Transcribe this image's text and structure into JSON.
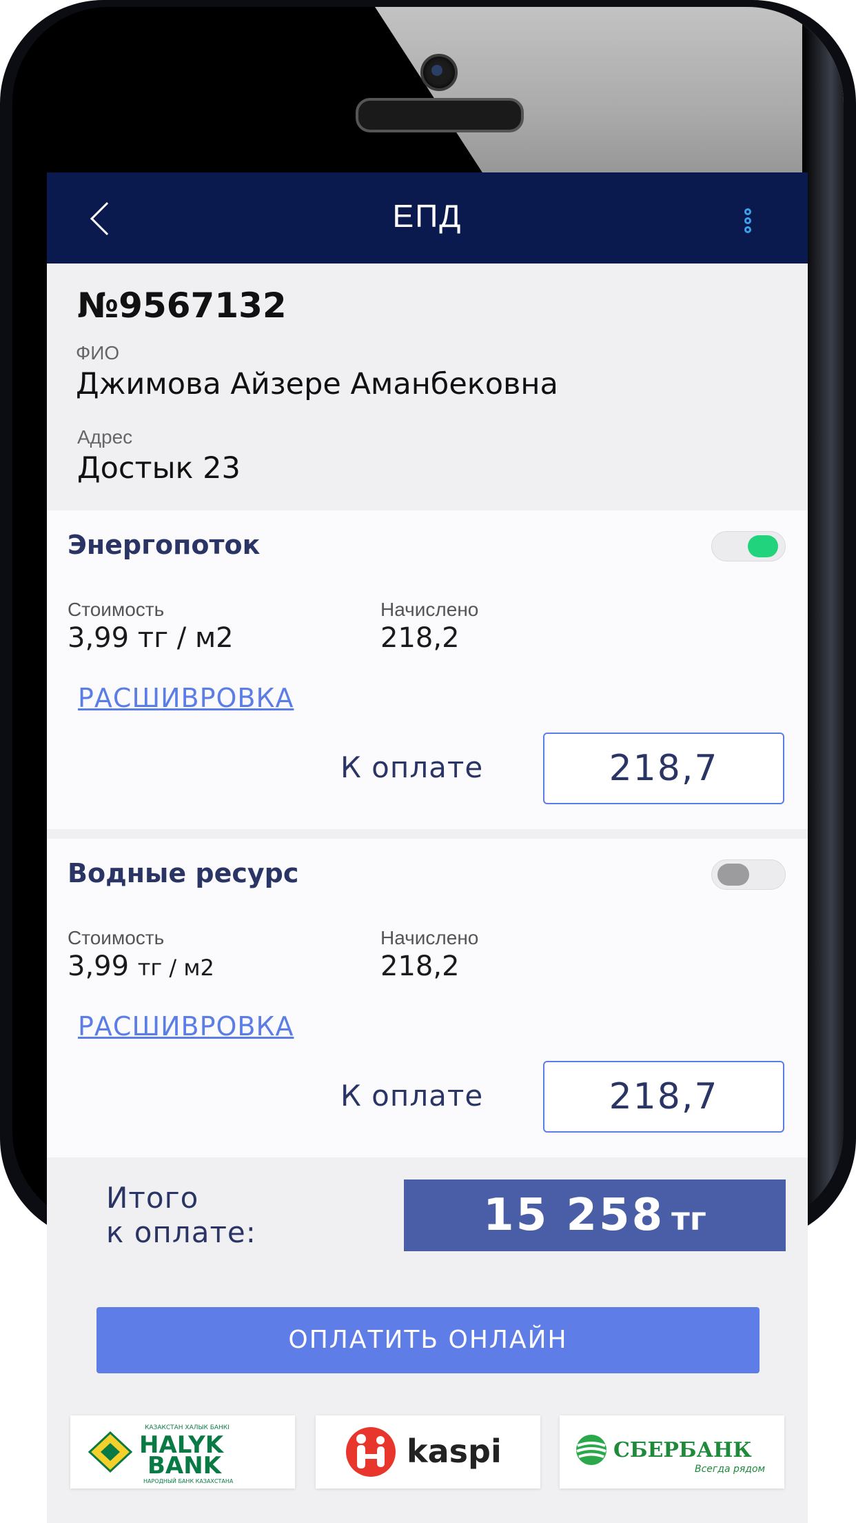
{
  "header": {
    "title": "ЕПД"
  },
  "account": {
    "number": "№9567132",
    "fio_label": "ФИО",
    "fio": "Джимова Айзере Аманбековна",
    "address_label": "Адрес",
    "address": "Достык 23"
  },
  "services": [
    {
      "name": "Энергопоток",
      "toggle_on": true,
      "cost_label": "Стоимость",
      "cost": "3,99 тг / м2",
      "charged_label": "Начислено",
      "charged": "218,2",
      "link": "РАСШИВРОВКА",
      "pay_label": "К оплате",
      "pay_value": "218,7"
    },
    {
      "name": "Водные ресурс",
      "toggle_on": false,
      "cost_label": "Стоимость",
      "cost_num": "3,99",
      "cost_unit": "тг / м2",
      "charged_label": "Начислено",
      "charged": "218,2",
      "link": "РАСШИВРОВКА",
      "pay_label": "К оплате",
      "pay_value": "218,7"
    }
  ],
  "total": {
    "label_line1": "Итого",
    "label_line2": "к оплате:",
    "amount": "15 258",
    "currency": "тг"
  },
  "pay_online_label": "ОПЛАТИТЬ ОНЛАЙН",
  "banks": {
    "halyk": {
      "top": "КАЗАКСТАН ХАЛЫК БАНКІ",
      "line1": "HALYK",
      "line2": "BANK",
      "bottom": "НАРОДНЫЙ БАНК КАЗАХСТАНА"
    },
    "kaspi": {
      "name": "kaspi"
    },
    "sber": {
      "name": "СБЕРБАНК",
      "tagline": "Всегда рядом"
    }
  },
  "colors": {
    "topbar": "#0b1a4e",
    "accent": "#5e7de6",
    "toggle_on": "#22d37e",
    "total_bg": "#4a5ea8"
  }
}
